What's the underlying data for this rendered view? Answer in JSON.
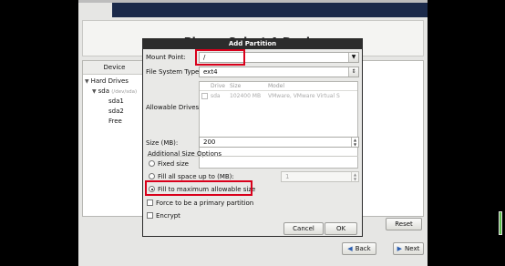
{
  "background": {
    "title": "Please Select A Device",
    "device_column": "Device",
    "tree": {
      "hard_drives": "Hard Drives",
      "sda": "sda",
      "sda_detail": "(/dev/sda)",
      "sda1": "sda1",
      "sda2": "sda2",
      "free": "Free"
    },
    "reset_label": "Reset",
    "ghost_text": "ete",
    "back_label": "Back",
    "next_label": "Next"
  },
  "dialog": {
    "title": "Add Partition",
    "mount_point_label": "Mount Point:",
    "mount_point_value": "/",
    "fs_type_label": "File System Type:",
    "fs_type_value": "ext4",
    "allowable_drives_label": "Allowable Drives:",
    "drives_headers": [
      "Drive",
      "Size",
      "Model"
    ],
    "drive_row": {
      "drive": "sda",
      "size": "102400 MB",
      "model": "VMware, VMware Virtual S"
    },
    "size_label": "Size (MB):",
    "size_value": "200",
    "additional_options_label": "Additional Size Options",
    "fixed_size_label": "Fixed size",
    "fill_up_to_label": "Fill all space up to (MB):",
    "fill_up_to_value": "1",
    "fill_max_label": "Fill to maximum allowable size",
    "primary_label": "Force to be a primary partition",
    "encrypt_label": "Encrypt",
    "cancel_label": "Cancel",
    "ok_label": "OK"
  },
  "colors": {
    "highlight": "#d9001b",
    "banner": "#1b2a4a"
  }
}
